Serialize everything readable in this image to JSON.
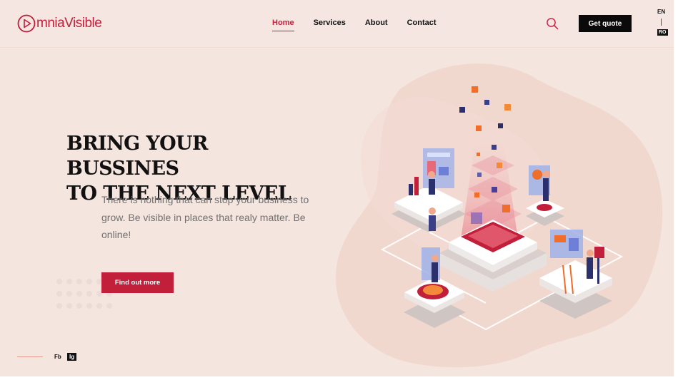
{
  "brand": {
    "name": "mniaVisible",
    "accent_color": "#c21f3a",
    "background_color": "#f5e5df"
  },
  "nav": {
    "items": [
      {
        "label": "Home",
        "active": true
      },
      {
        "label": "Services",
        "active": false
      },
      {
        "label": "About",
        "active": false
      },
      {
        "label": "Contact",
        "active": false
      }
    ],
    "search_icon": "search-icon",
    "cta_label": "Get quote"
  },
  "languages": {
    "primary": "EN",
    "secondary": "RO"
  },
  "hero": {
    "title_line1": "BRING YOUR BUSSINES",
    "title_line2": "TO THE NEXT LEVEL",
    "description": "There is nothing that can stop your business to grow. Be visible in places that realy matter. Be online!",
    "button_label": "Find out more",
    "illustration_icon": "isometric-business-platform-illustration"
  },
  "social": {
    "facebook": "Fb",
    "instagram": "Ig"
  }
}
